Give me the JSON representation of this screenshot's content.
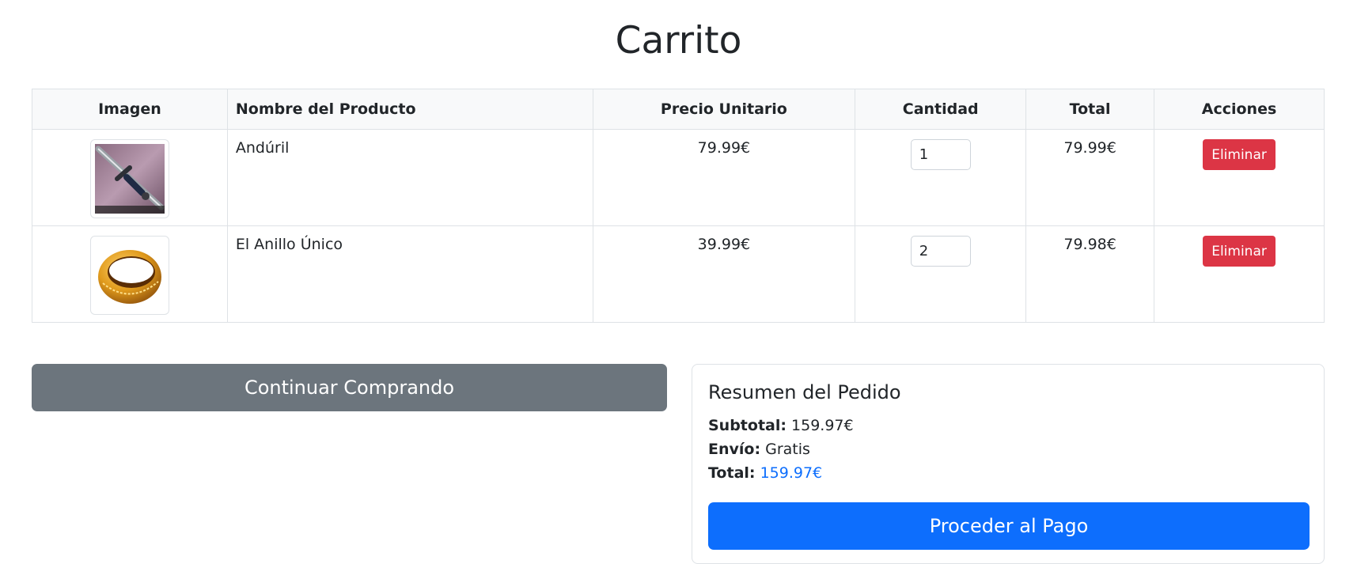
{
  "page": {
    "title": "Carrito"
  },
  "table": {
    "headers": [
      "Imagen",
      "Nombre del Producto",
      "Precio Unitario",
      "Cantidad",
      "Total",
      "Acciones"
    ],
    "rows": [
      {
        "name": "Andúril",
        "unit_price": "79.99€",
        "quantity": "1",
        "total": "79.99€",
        "action": "Eliminar",
        "image_icon": "sword-image"
      },
      {
        "name": "El Anillo Único",
        "unit_price": "39.99€",
        "quantity": "2",
        "total": "79.98€",
        "action": "Eliminar",
        "image_icon": "ring-image"
      }
    ]
  },
  "actions": {
    "continue_label": "Continuar Comprando"
  },
  "summary": {
    "title": "Resumen del Pedido",
    "subtotal_label": "Subtotal:",
    "subtotal_value": "159.97€",
    "shipping_label": "Envío:",
    "shipping_value": "Gratis",
    "total_label": "Total:",
    "total_value": "159.97€",
    "pay_label": "Proceder al Pago"
  },
  "colors": {
    "danger": "#dc3545",
    "primary": "#0d6efd",
    "secondary": "#6c757d"
  }
}
